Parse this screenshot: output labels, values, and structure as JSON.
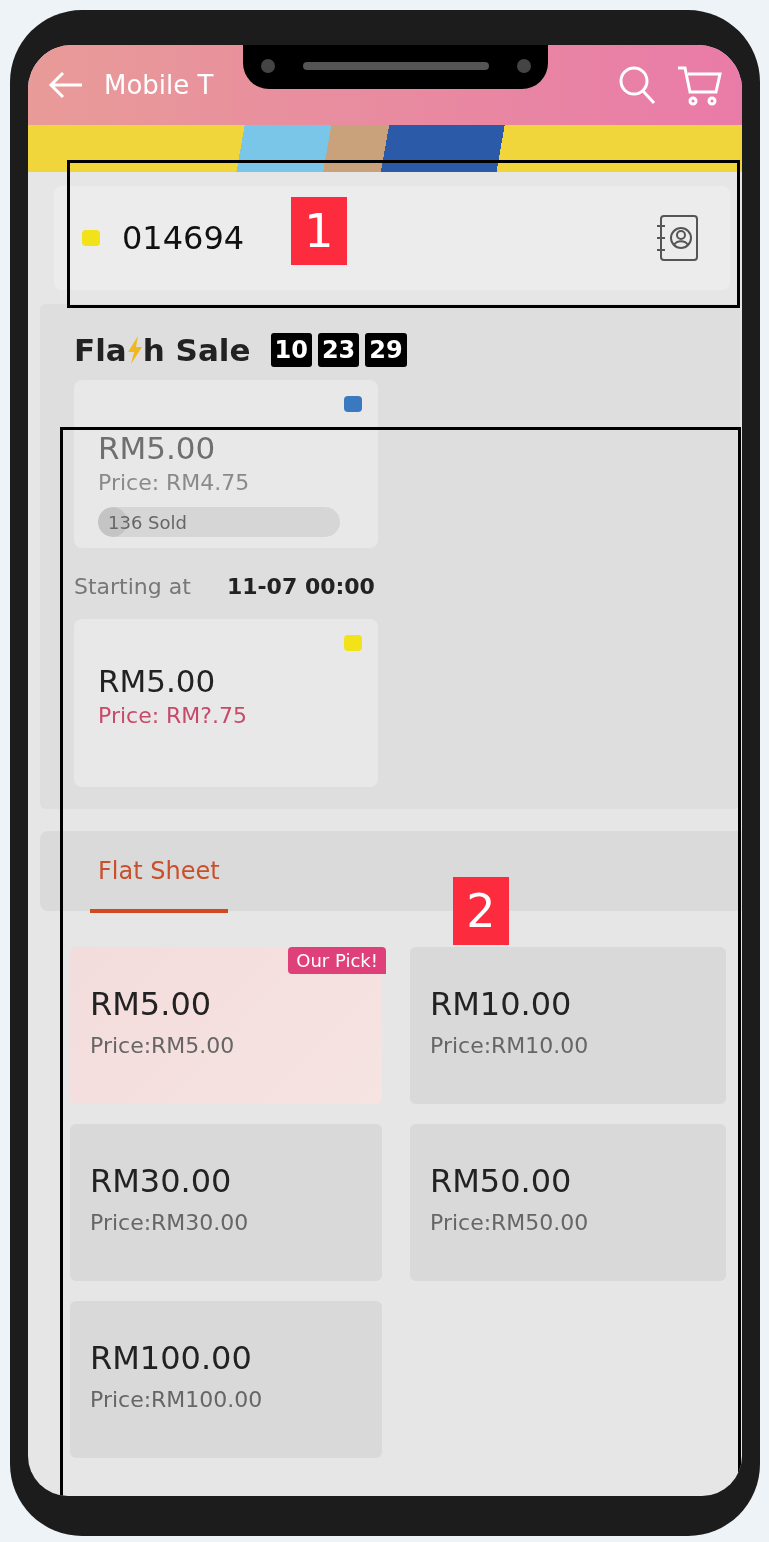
{
  "header": {
    "title": "Mobile T"
  },
  "phone_field": {
    "value": "014694"
  },
  "flash_sale": {
    "title_before": "Fla",
    "title_after": "h Sale",
    "timer": [
      "10",
      "23",
      "29"
    ],
    "items": [
      {
        "kind": "selling",
        "amount": "RM5.00",
        "price": "Price: RM4.75",
        "sold": "136 Sold",
        "level": 0.12
      },
      {
        "kind": "upcoming",
        "starting_label": "Starting at",
        "starting_time": "11-07 00:00",
        "amount": "RM5.00",
        "price": "Price: RM?.75"
      }
    ]
  },
  "tabs": [
    {
      "label": "Flat Sheet",
      "selected": true
    }
  ],
  "products": [
    {
      "amount": "RM5.00",
      "price": "Price:RM5.00",
      "badge": "Our Pick!",
      "selected": true
    },
    {
      "amount": "RM10.00",
      "price": "Price:RM10.00",
      "selected": false
    },
    {
      "amount": "RM30.00",
      "price": "Price:RM30.00",
      "selected": false
    },
    {
      "amount": "RM50.00",
      "price": "Price:RM50.00",
      "selected": false
    },
    {
      "amount": "RM100.00",
      "price": "Price:RM100.00",
      "selected": false
    }
  ],
  "annotations": [
    {
      "label": "1"
    },
    {
      "label": "2"
    }
  ]
}
